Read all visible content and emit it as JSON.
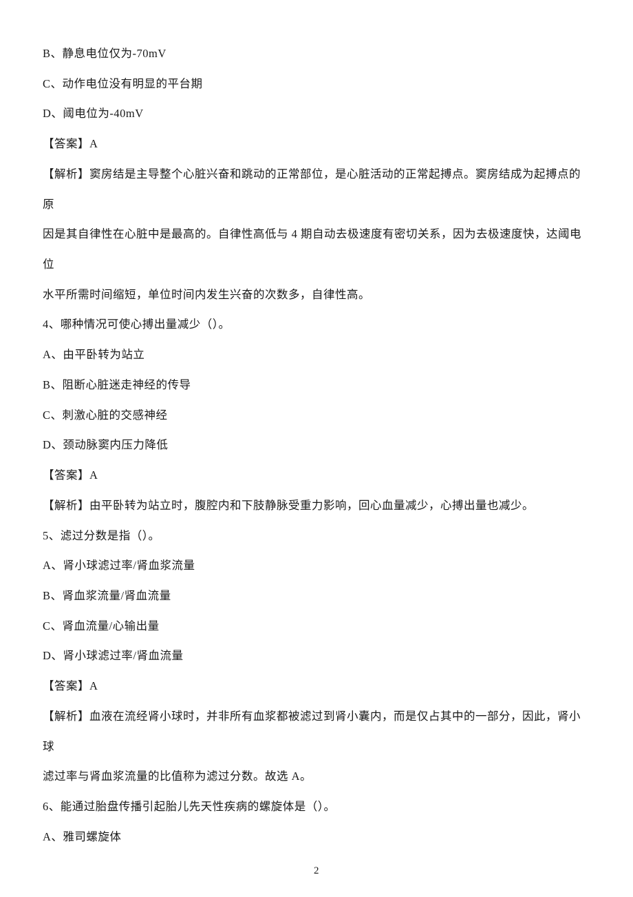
{
  "lines": {
    "l01": "B、静息电位仅为-70mV",
    "l02": "C、动作电位没有明显的平台期",
    "l03": "D、阈电位为-40mV",
    "l04": "【答案】A",
    "l05": "【解析】窦房结是主导整个心脏兴奋和跳动的正常部位，是心脏活动的正常起搏点。窦房结成为起搏点的原",
    "l06": "因是其自律性在心脏中是最高的。自律性高低与 4 期自动去极速度有密切关系，因为去极速度快，达阈电位",
    "l07": "水平所需时间缩短，单位时间内发生兴奋的次数多，自律性高。",
    "l08": "4、哪种情况可使心搏出量减少（）。",
    "l09": "A、由平卧转为站立",
    "l10": "B、阻断心脏迷走神经的传导",
    "l11": "C、刺激心脏的交感神经",
    "l12": "D、颈动脉窦内压力降低",
    "l13": "【答案】A",
    "l14": "【解析】由平卧转为站立时，腹腔内和下肢静脉受重力影响，回心血量减少，心搏出量也减少。",
    "l15": "5、滤过分数是指（）。",
    "l16": "A、肾小球滤过率/肾血浆流量",
    "l17": "B、肾血浆流量/肾血流量",
    "l18": "C、肾血流量/心输出量",
    "l19": "D、肾小球滤过率/肾血流量",
    "l20": "【答案】A",
    "l21": "【解析】血液在流经肾小球时，并非所有血浆都被滤过到肾小囊内，而是仅占其中的一部分，因此，肾小球",
    "l22": "滤过率与肾血浆流量的比值称为滤过分数。故选 A。",
    "l23": "6、能通过胎盘传播引起胎儿先天性疾病的螺旋体是（）。",
    "l24": "A、雅司螺旋体"
  },
  "page_number": "2"
}
